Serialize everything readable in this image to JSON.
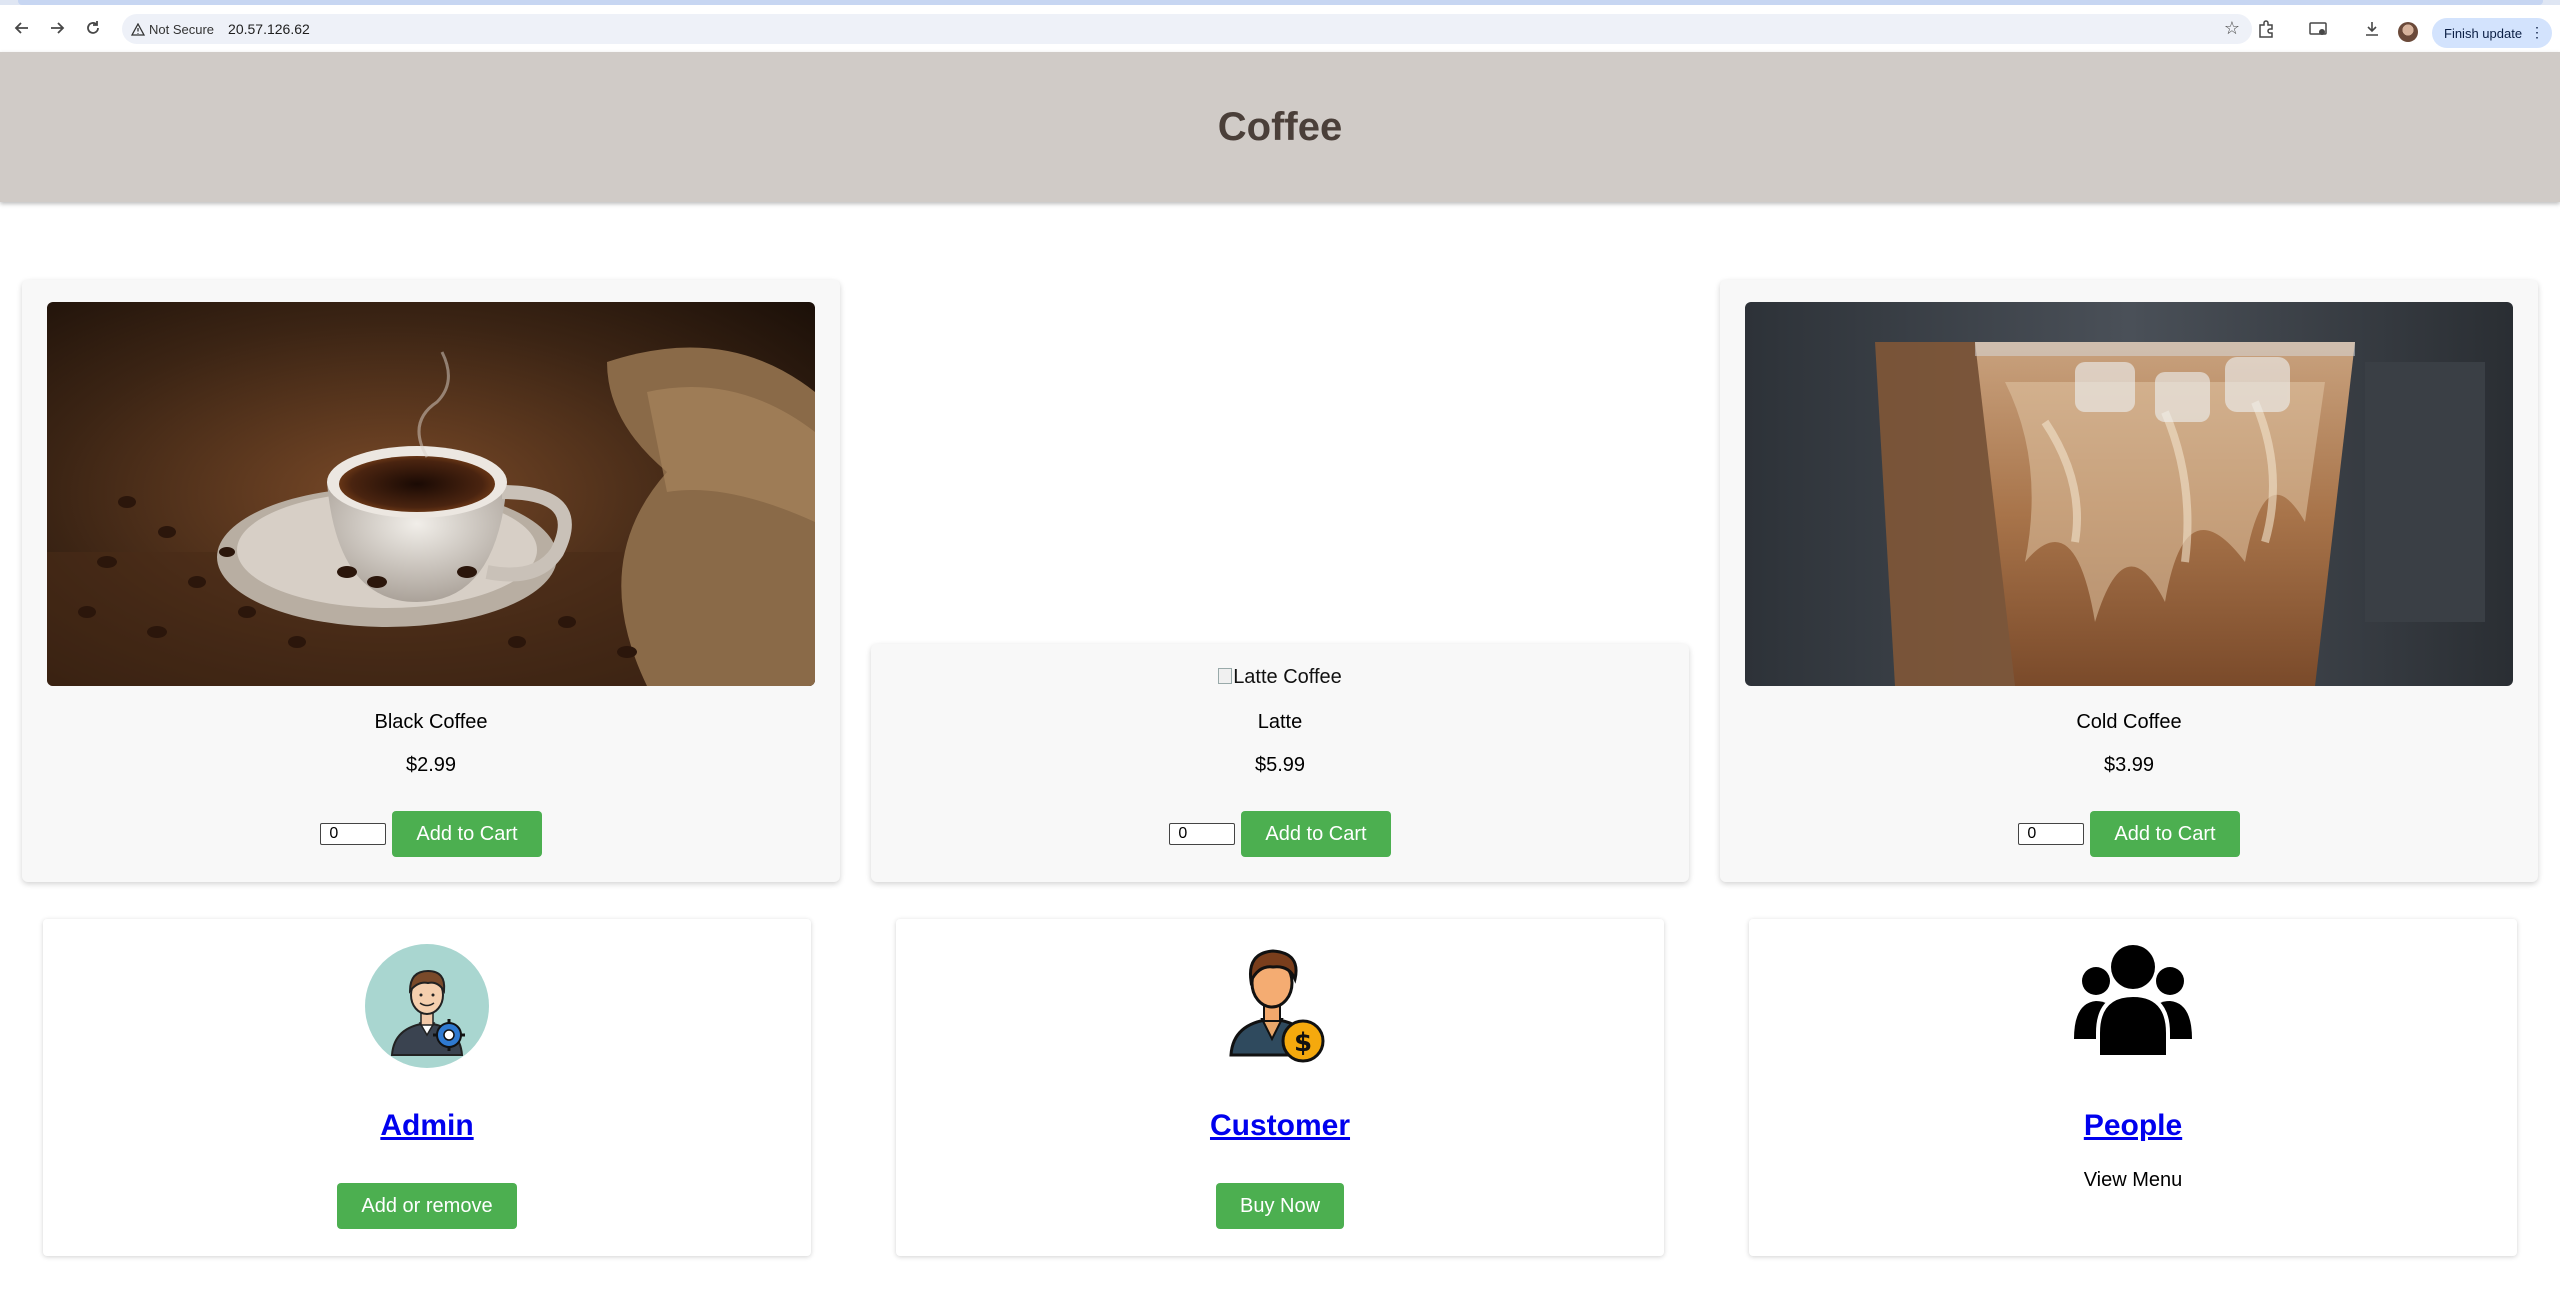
{
  "browser": {
    "security_label": "Not Secure",
    "url": "20.57.126.62",
    "finish_update_label": "Finish update"
  },
  "header": {
    "title": "Coffee"
  },
  "products": [
    {
      "name": "Black Coffee",
      "price": "$2.99",
      "quantity": "0",
      "button": "Add to Cart",
      "image_alt": ""
    },
    {
      "name": "Latte",
      "price": "$5.99",
      "quantity": "0",
      "button": "Add to Cart",
      "image_alt": "Latte Coffee"
    },
    {
      "name": "Cold Coffee",
      "price": "$3.99",
      "quantity": "0",
      "button": "Add to Cart",
      "image_alt": ""
    }
  ],
  "roles": [
    {
      "title": "Admin",
      "button": "Add or remove",
      "icon": "admin-icon"
    },
    {
      "title": "Customer",
      "button": "Buy Now",
      "icon": "customer-icon"
    },
    {
      "title": "People",
      "text": "View Menu",
      "icon": "people-icon"
    }
  ],
  "colors": {
    "header_bg": "#d0cbc7",
    "title_color": "#4a3f39",
    "button_green": "#4caf50",
    "link_blue": "#0000ee"
  }
}
